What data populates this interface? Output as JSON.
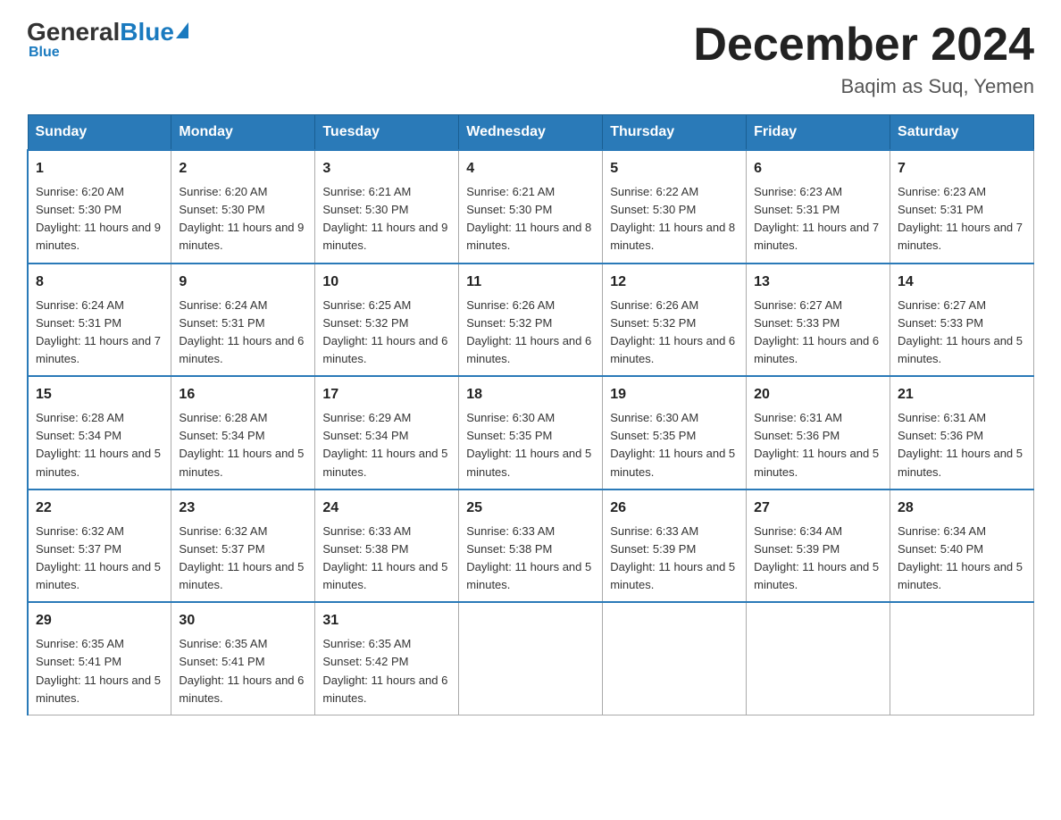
{
  "logo": {
    "general": "General",
    "blue": "Blue",
    "subtitle": "Blue"
  },
  "title": "December 2024",
  "subtitle": "Baqim as Suq, Yemen",
  "days_of_week": [
    "Sunday",
    "Monday",
    "Tuesday",
    "Wednesday",
    "Thursday",
    "Friday",
    "Saturday"
  ],
  "weeks": [
    [
      {
        "day": "1",
        "sunrise": "Sunrise: 6:20 AM",
        "sunset": "Sunset: 5:30 PM",
        "daylight": "Daylight: 11 hours and 9 minutes."
      },
      {
        "day": "2",
        "sunrise": "Sunrise: 6:20 AM",
        "sunset": "Sunset: 5:30 PM",
        "daylight": "Daylight: 11 hours and 9 minutes."
      },
      {
        "day": "3",
        "sunrise": "Sunrise: 6:21 AM",
        "sunset": "Sunset: 5:30 PM",
        "daylight": "Daylight: 11 hours and 9 minutes."
      },
      {
        "day": "4",
        "sunrise": "Sunrise: 6:21 AM",
        "sunset": "Sunset: 5:30 PM",
        "daylight": "Daylight: 11 hours and 8 minutes."
      },
      {
        "day": "5",
        "sunrise": "Sunrise: 6:22 AM",
        "sunset": "Sunset: 5:30 PM",
        "daylight": "Daylight: 11 hours and 8 minutes."
      },
      {
        "day": "6",
        "sunrise": "Sunrise: 6:23 AM",
        "sunset": "Sunset: 5:31 PM",
        "daylight": "Daylight: 11 hours and 7 minutes."
      },
      {
        "day": "7",
        "sunrise": "Sunrise: 6:23 AM",
        "sunset": "Sunset: 5:31 PM",
        "daylight": "Daylight: 11 hours and 7 minutes."
      }
    ],
    [
      {
        "day": "8",
        "sunrise": "Sunrise: 6:24 AM",
        "sunset": "Sunset: 5:31 PM",
        "daylight": "Daylight: 11 hours and 7 minutes."
      },
      {
        "day": "9",
        "sunrise": "Sunrise: 6:24 AM",
        "sunset": "Sunset: 5:31 PM",
        "daylight": "Daylight: 11 hours and 6 minutes."
      },
      {
        "day": "10",
        "sunrise": "Sunrise: 6:25 AM",
        "sunset": "Sunset: 5:32 PM",
        "daylight": "Daylight: 11 hours and 6 minutes."
      },
      {
        "day": "11",
        "sunrise": "Sunrise: 6:26 AM",
        "sunset": "Sunset: 5:32 PM",
        "daylight": "Daylight: 11 hours and 6 minutes."
      },
      {
        "day": "12",
        "sunrise": "Sunrise: 6:26 AM",
        "sunset": "Sunset: 5:32 PM",
        "daylight": "Daylight: 11 hours and 6 minutes."
      },
      {
        "day": "13",
        "sunrise": "Sunrise: 6:27 AM",
        "sunset": "Sunset: 5:33 PM",
        "daylight": "Daylight: 11 hours and 6 minutes."
      },
      {
        "day": "14",
        "sunrise": "Sunrise: 6:27 AM",
        "sunset": "Sunset: 5:33 PM",
        "daylight": "Daylight: 11 hours and 5 minutes."
      }
    ],
    [
      {
        "day": "15",
        "sunrise": "Sunrise: 6:28 AM",
        "sunset": "Sunset: 5:34 PM",
        "daylight": "Daylight: 11 hours and 5 minutes."
      },
      {
        "day": "16",
        "sunrise": "Sunrise: 6:28 AM",
        "sunset": "Sunset: 5:34 PM",
        "daylight": "Daylight: 11 hours and 5 minutes."
      },
      {
        "day": "17",
        "sunrise": "Sunrise: 6:29 AM",
        "sunset": "Sunset: 5:34 PM",
        "daylight": "Daylight: 11 hours and 5 minutes."
      },
      {
        "day": "18",
        "sunrise": "Sunrise: 6:30 AM",
        "sunset": "Sunset: 5:35 PM",
        "daylight": "Daylight: 11 hours and 5 minutes."
      },
      {
        "day": "19",
        "sunrise": "Sunrise: 6:30 AM",
        "sunset": "Sunset: 5:35 PM",
        "daylight": "Daylight: 11 hours and 5 minutes."
      },
      {
        "day": "20",
        "sunrise": "Sunrise: 6:31 AM",
        "sunset": "Sunset: 5:36 PM",
        "daylight": "Daylight: 11 hours and 5 minutes."
      },
      {
        "day": "21",
        "sunrise": "Sunrise: 6:31 AM",
        "sunset": "Sunset: 5:36 PM",
        "daylight": "Daylight: 11 hours and 5 minutes."
      }
    ],
    [
      {
        "day": "22",
        "sunrise": "Sunrise: 6:32 AM",
        "sunset": "Sunset: 5:37 PM",
        "daylight": "Daylight: 11 hours and 5 minutes."
      },
      {
        "day": "23",
        "sunrise": "Sunrise: 6:32 AM",
        "sunset": "Sunset: 5:37 PM",
        "daylight": "Daylight: 11 hours and 5 minutes."
      },
      {
        "day": "24",
        "sunrise": "Sunrise: 6:33 AM",
        "sunset": "Sunset: 5:38 PM",
        "daylight": "Daylight: 11 hours and 5 minutes."
      },
      {
        "day": "25",
        "sunrise": "Sunrise: 6:33 AM",
        "sunset": "Sunset: 5:38 PM",
        "daylight": "Daylight: 11 hours and 5 minutes."
      },
      {
        "day": "26",
        "sunrise": "Sunrise: 6:33 AM",
        "sunset": "Sunset: 5:39 PM",
        "daylight": "Daylight: 11 hours and 5 minutes."
      },
      {
        "day": "27",
        "sunrise": "Sunrise: 6:34 AM",
        "sunset": "Sunset: 5:39 PM",
        "daylight": "Daylight: 11 hours and 5 minutes."
      },
      {
        "day": "28",
        "sunrise": "Sunrise: 6:34 AM",
        "sunset": "Sunset: 5:40 PM",
        "daylight": "Daylight: 11 hours and 5 minutes."
      }
    ],
    [
      {
        "day": "29",
        "sunrise": "Sunrise: 6:35 AM",
        "sunset": "Sunset: 5:41 PM",
        "daylight": "Daylight: 11 hours and 5 minutes."
      },
      {
        "day": "30",
        "sunrise": "Sunrise: 6:35 AM",
        "sunset": "Sunset: 5:41 PM",
        "daylight": "Daylight: 11 hours and 6 minutes."
      },
      {
        "day": "31",
        "sunrise": "Sunrise: 6:35 AM",
        "sunset": "Sunset: 5:42 PM",
        "daylight": "Daylight: 11 hours and 6 minutes."
      },
      null,
      null,
      null,
      null
    ]
  ]
}
